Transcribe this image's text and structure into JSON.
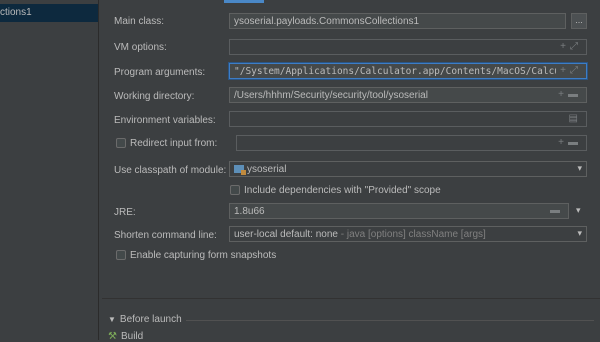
{
  "left": {
    "selected_item": "ctions1"
  },
  "form": {
    "main_class": {
      "label": "Main class:",
      "value": "ysoserial.payloads.CommonsCollections1",
      "button": "..."
    },
    "vm_options": {
      "label": "VM options:",
      "value": ""
    },
    "program_arguments": {
      "label": "Program arguments:",
      "value": "\"/System/Applications/Calculator.app/Contents/MacOS/Calculator\""
    },
    "working_directory": {
      "label": "Working directory:",
      "value": "/Users/hhhm/Security/security/tool/ysoserial"
    },
    "env_vars": {
      "label": "Environment variables:",
      "value": ""
    },
    "redirect_input": {
      "label": "Redirect input from:",
      "value": ""
    },
    "classpath": {
      "label": "Use classpath of module:",
      "value": "ysoserial"
    },
    "include_deps": {
      "label": "Include dependencies with \"Provided\" scope"
    },
    "jre": {
      "label": "JRE:",
      "value": "1.8u66"
    },
    "shorten": {
      "label": "Shorten command line:",
      "value": "user-local default: none",
      "hint": " - java [options] className [args]"
    },
    "form_snapshots": {
      "label": "Enable capturing form snapshots"
    }
  },
  "before_launch": {
    "label": "Before launch",
    "items": [
      "Build"
    ]
  },
  "icons": {
    "expand": "⤢",
    "plus": "+",
    "folder": "▬",
    "dropdown": "▾",
    "doc": "▤"
  }
}
